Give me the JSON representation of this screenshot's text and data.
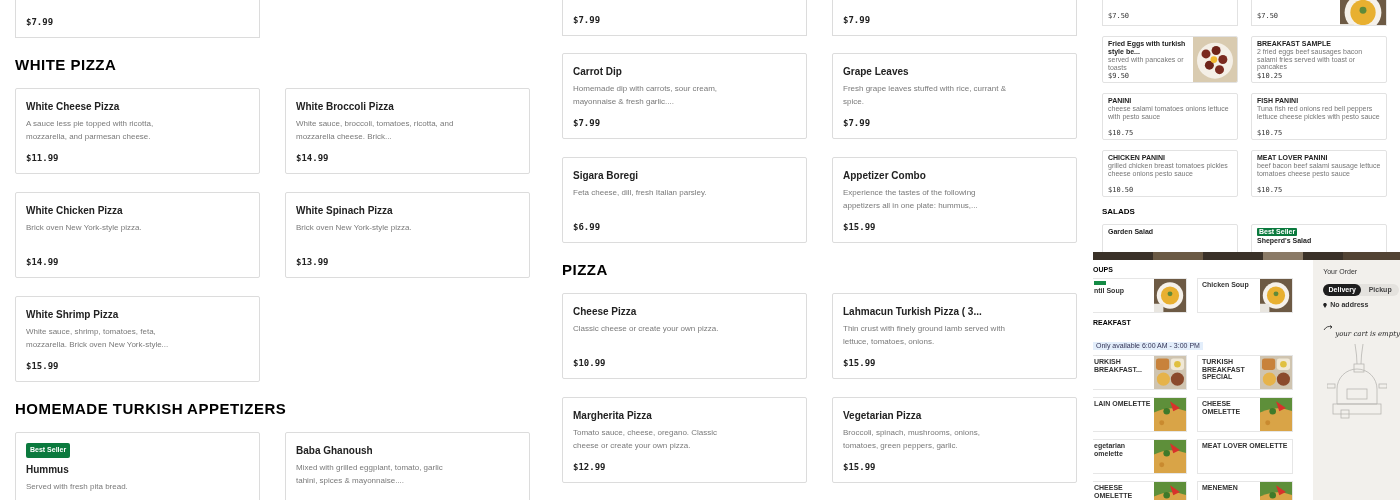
{
  "left_page": {
    "sections": [
      {
        "items": [
          {
            "kind": "partial",
            "price": "$7.99"
          }
        ]
      },
      {
        "heading": "WHITE PIZZA",
        "items": [
          {
            "kind": "item",
            "title": "White Cheese Pizza",
            "description": "A sauce less pie topped with ricotta, mozzarella, and parmesan cheese.",
            "price": "$11.99"
          },
          {
            "kind": "item",
            "title": "White Broccoli Pizza",
            "description": "White sauce, broccoli, tomatoes, ricotta, and mozzarella cheese. Brick...",
            "price": "$14.99"
          },
          {
            "kind": "item",
            "title": "White Chicken Pizza",
            "description": "Brick oven New York-style pizza.",
            "price": "$14.99"
          },
          {
            "kind": "item",
            "title": "White Spinach Pizza",
            "description": "Brick oven New York-style pizza.",
            "price": "$13.99"
          },
          {
            "kind": "item",
            "title": "White Shrimp Pizza",
            "description": "White sauce, shrimp, tomatoes, feta, mozzarella. Brick oven New York-style...",
            "price": "$15.99"
          }
        ]
      },
      {
        "heading": "HOMEMADE TURKISH APPETIZERS",
        "items": [
          {
            "kind": "item",
            "badge": "Best Seller",
            "title": "Hummus",
            "description": "Served with fresh pita bread."
          },
          {
            "kind": "item",
            "title": "Baba Ghanoush",
            "description": "Mixed with grilled eggplant, tomato, garlic tahini, spices & mayonnaise...."
          }
        ]
      }
    ]
  },
  "middle_page": {
    "sections": [
      {
        "items": [
          {
            "kind": "partial",
            "price": "$7.99"
          },
          {
            "kind": "partial",
            "price": "$7.99"
          },
          {
            "kind": "item",
            "title": "Carrot Dip",
            "description": "Homemade dip with carrots, sour cream, mayonnaise & fresh garlic....",
            "price": "$7.99"
          },
          {
            "kind": "item",
            "title": "Grape Leaves",
            "description": "Fresh grape leaves stuffed with rice, currant & spice.",
            "price": "$7.99"
          },
          {
            "kind": "item",
            "title": "Sigara Boregi",
            "description": "Feta cheese, dill, fresh Italian parsley.",
            "price": "$6.99"
          },
          {
            "kind": "item",
            "title": "Appetizer Combo",
            "description": "Experience the tastes of the following appetizers all in one plate: hummus,...",
            "price": "$15.99"
          }
        ]
      },
      {
        "heading": "PIZZA",
        "items": [
          {
            "kind": "item",
            "title": "Cheese Pizza",
            "description": "Classic cheese or create your own pizza.",
            "price": "$10.99"
          },
          {
            "kind": "item",
            "title": "Lahmacun Turkish Pizza ( 3...",
            "description": "Thin crust with finely ground lamb served with lettuce, tomatoes, onions.",
            "price": "$15.99"
          },
          {
            "kind": "item",
            "title": "Margherita Pizza",
            "description": "Tomato sauce, cheese, oregano. Classic cheese or create your own pizza.",
            "price": "$12.99"
          },
          {
            "kind": "item",
            "title": "Vegetarian Pizza",
            "description": "Broccoli, spinach, mushrooms, onions, tomatoes, green peppers, garlic.",
            "price": "$15.99"
          }
        ]
      }
    ]
  },
  "thumbnail_top": {
    "sections": [
      {
        "items": [
          {
            "kind": "partial",
            "price": "$7.50"
          },
          {
            "kind": "partial",
            "price": "$7.50",
            "photo": true
          },
          {
            "kind": "item",
            "title": "Fried Eggs with turkish style be...",
            "description": "served with pancakes or toasts",
            "price": "$9.50",
            "photo": true
          },
          {
            "kind": "item",
            "title": "BREAKFAST SAMPLE",
            "description": "2 fried eggs beef sausages bacon salami fries served with toast or pancakes",
            "price": "$10.25"
          },
          {
            "kind": "item",
            "title": "PANINI",
            "description": "cheese salami tomatoes onions lettuce with pesto sauce",
            "price": "$10.75"
          },
          {
            "kind": "item",
            "title": "FISH PANINI",
            "description": "Tuna fish red onions red bell peppers lettuce cheese pickles with pesto sauce",
            "price": "$10.75"
          },
          {
            "kind": "item",
            "title": "CHICKEN PANINI",
            "description": "grilled chicken breast tomatoes pickles cheese onions pesto sauce",
            "price": "$10.50"
          },
          {
            "kind": "item",
            "title": "MEAT LOVER PANINI",
            "description": "beef bacon beef salami sausage lettuce tomatoes cheese pesto sauce",
            "price": "$10.75"
          }
        ]
      },
      {
        "heading": "SALADS",
        "items": [
          {
            "kind": "item",
            "title": "Garden Salad"
          },
          {
            "kind": "item",
            "badge": "Best Seller",
            "title": "Sheperd's Salad"
          }
        ]
      }
    ]
  },
  "thumbnail_bottom": {
    "sections": [
      {
        "heading": "OUPS",
        "items": [
          {
            "kind": "item",
            "tag": true,
            "title": "ntil Soup",
            "photo": true
          },
          {
            "kind": "item",
            "title": "Chicken Soup",
            "photo": true
          }
        ]
      },
      {
        "heading": "REAKFAST",
        "note": "Only available 6:00 AM - 3:00 PM",
        "items": [
          {
            "kind": "item",
            "title": "URKISH BREAKFAST...",
            "photo": true
          },
          {
            "kind": "item",
            "title": "TURKISH BREAKFAST SPECIAL",
            "photo": true
          },
          {
            "kind": "item",
            "title": "LAIN OMELETTE",
            "photo": true
          },
          {
            "kind": "item",
            "title": "CHEESE OMELETTE",
            "photo": true
          },
          {
            "kind": "item",
            "title": "egetarian omelette",
            "photo": true
          },
          {
            "kind": "item",
            "title": "MEAT LOVER OMELETTE"
          },
          {
            "kind": "item",
            "title": "CHEESE OMELETTE",
            "photo": true
          },
          {
            "kind": "item",
            "title": "MENEMEN",
            "photo": true
          }
        ]
      }
    ],
    "order": {
      "title": "Your Order",
      "modes": [
        {
          "label": "Delivery",
          "selected": true
        },
        {
          "label": "Pickup",
          "selected": false
        }
      ],
      "address": "No address",
      "empty_note": "your cart is empty"
    }
  }
}
